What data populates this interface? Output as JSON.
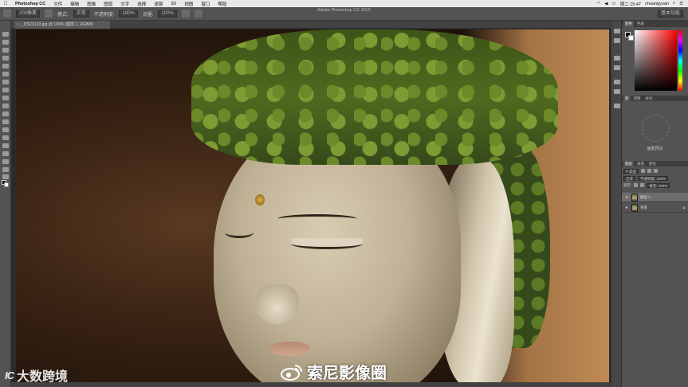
{
  "menubar": {
    "app_name": "Photoshop CC",
    "items": [
      "文件",
      "编辑",
      "图像",
      "图层",
      "文字",
      "选择",
      "滤镜",
      "3D",
      "视图",
      "窗口",
      "帮助"
    ],
    "time": "周二 15:47",
    "user": "chuangyuan"
  },
  "window_title": "Adobe Photoshop CC 2015",
  "options_bar": {
    "size": "200像素",
    "mode_label": "模式:",
    "mode": "正常",
    "opacity_label": "不透明度:",
    "opacity": "100%",
    "flow_label": "流量:",
    "flow": "100%",
    "workspace": "基本功能"
  },
  "document_tab": {
    "name": "_DSC0123.jpg @ 100% (图层 1, RGB/8)"
  },
  "panels": {
    "color_tabs": [
      "颜色",
      "色板"
    ],
    "library_tabs": [
      "库",
      "调整",
      "样式"
    ],
    "brush_label": "画笔预设",
    "layer_tabs": [
      "图层",
      "通道",
      "路径"
    ],
    "kind_filter": "P 类型",
    "blend_mode": "正常",
    "opacity": "不透明度: 100%",
    "lock_label": "锁定:",
    "fill": "填充: 100%",
    "layers": [
      {
        "name": "图层 1",
        "visible": true,
        "selected": true,
        "locked": false
      },
      {
        "name": "背景",
        "visible": true,
        "selected": false,
        "locked": true
      }
    ]
  },
  "watermarks": {
    "brand_logo": "IC",
    "brand_text": "大数跨境",
    "weibo_text": "索尼影像圈"
  },
  "colors": {
    "foreground": "#000000",
    "background": "#ffffff",
    "ui_dark": "#535353"
  }
}
